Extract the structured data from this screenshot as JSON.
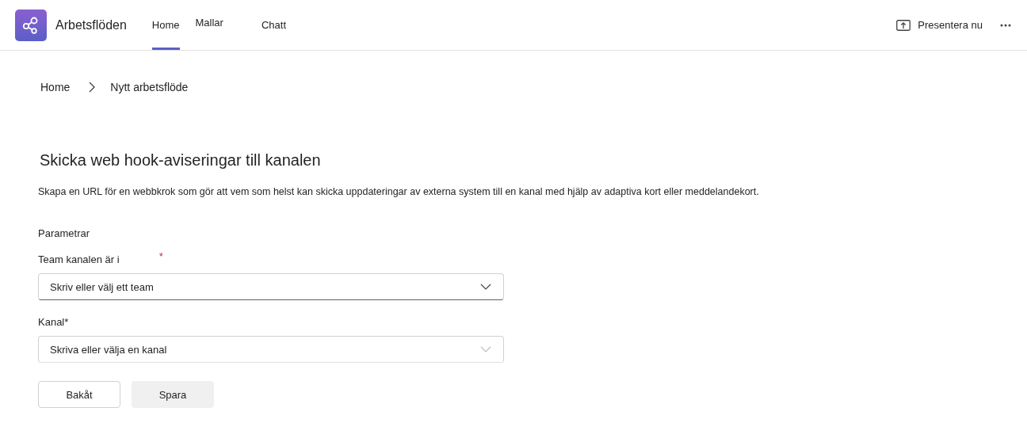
{
  "app": {
    "title": "Arbetsflöden"
  },
  "tabs": [
    {
      "label": "Home",
      "selected": true
    },
    {
      "label": "Mallar",
      "selected": false
    },
    {
      "label": "Chatt",
      "selected": false
    }
  ],
  "header_actions": {
    "present": "Presentera nu"
  },
  "breadcrumb": [
    "Home",
    "Nytt arbetsflöde"
  ],
  "heading": "Skicka web hook-aviseringar till kanalen",
  "description": "Skapa en URL för en webbkrok som gör att vem som helst kan skicka uppdateringar av externa system till en kanal med hjälp av adaptiva kort eller meddelandekort.",
  "section_label": "Parametrar",
  "fields": [
    {
      "label": "Team kanalen är i",
      "required_mark": "*",
      "placeholder": "Skriv eller välj ett team",
      "disabled": false
    },
    {
      "label": "Kanal*",
      "placeholder": "Skriva eller välja en kanal",
      "disabled": true
    }
  ],
  "buttons": [
    {
      "label": "Bakåt",
      "disabled": false
    },
    {
      "label": "Spara",
      "disabled": true
    }
  ]
}
